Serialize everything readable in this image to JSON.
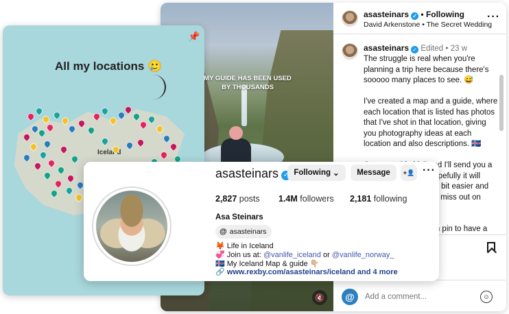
{
  "post": {
    "photo_caption": "MY GUIDE HAS BEEN USED BY THOUSANDS",
    "header": {
      "username": "asasteinars",
      "separator": "•",
      "following": "Following",
      "subtitle": "David Arkenstone • The Secret Wedding"
    },
    "caption": {
      "username": "asasteinars",
      "edited": "Edited",
      "dot": "•",
      "age": "23 w",
      "text": "The struggle is real when you're planning a trip here because there's sooooo many places to see. 😅\n\nI've created a map and a guide, where each location that is listed has photos that I've shot in that location, giving you photography ideas at each location and also descriptions. 🇮🇸\n\nComment \"Guide\" and I'll send you a direct link to it and hopefully it will make your planning a bit easier and ensure that you won't miss out on anything!\n\nPs. If you tap on each pin to have a look at it you get an idea of how the places look from many angles"
    },
    "comment_placeholder": "Add a comment..."
  },
  "map": {
    "title": "All my locations 🥲",
    "island_label": "Iceland"
  },
  "profile": {
    "username": "asasteinars",
    "following_button": "Following",
    "message_button": "Message",
    "add_person_icon": "+👤",
    "stats": [
      {
        "value": "2,827",
        "label": "posts"
      },
      {
        "value": "1.4M",
        "label": "followers"
      },
      {
        "value": "2,181",
        "label": "following"
      }
    ],
    "name": "Asa Steinars",
    "threads_handle": "asasteinars",
    "bio": {
      "line1": "🦊 Life in Iceland",
      "line2_prefix": "💞 Join us at: ",
      "line2_link1": "@vanlife_iceland",
      "line2_mid": " or ",
      "line2_link2": "@vanlife_norway_",
      "line3": "🇮🇸 My Iceland Map & guide 👇🏼"
    },
    "external_link": "www.rexby.com/asasteinars/iceland and 4 more"
  },
  "colors": {
    "verified": "#1d9bf0",
    "link": "#4458a8",
    "map_water": "#a8d7dc"
  }
}
